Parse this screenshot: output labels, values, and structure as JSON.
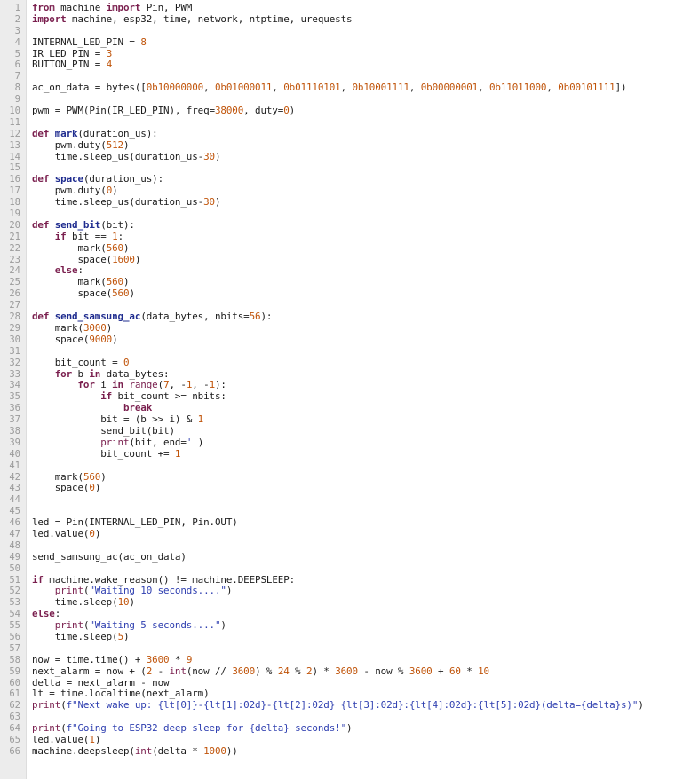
{
  "editor": {
    "theme": {
      "keyword": "#7a1f4e",
      "function": "#1f2c8f",
      "number": "#c0540a",
      "string": "#2f3fb0",
      "text": "#1b1b1b",
      "gutter_bg": "#ececec"
    },
    "lines": [
      [
        [
          "kw",
          "from"
        ],
        [
          "t",
          " machine "
        ],
        [
          "kw",
          "import"
        ],
        [
          "t",
          " Pin, PWM"
        ]
      ],
      [
        [
          "kw",
          "import"
        ],
        [
          "t",
          " machine, esp32, time, network, ntptime, urequests"
        ]
      ],
      [],
      [
        [
          "t",
          "INTERNAL_LED_PIN = "
        ],
        [
          "num",
          "8"
        ]
      ],
      [
        [
          "t",
          "IR_LED_PIN = "
        ],
        [
          "num",
          "3"
        ]
      ],
      [
        [
          "t",
          "BUTTON_PIN = "
        ],
        [
          "num",
          "4"
        ]
      ],
      [],
      [
        [
          "t",
          "ac_on_data = bytes(["
        ],
        [
          "num",
          "0b10000000"
        ],
        [
          "t",
          ", "
        ],
        [
          "num",
          "0b01000011"
        ],
        [
          "t",
          ", "
        ],
        [
          "num",
          "0b01110101"
        ],
        [
          "t",
          ", "
        ],
        [
          "num",
          "0b10001111"
        ],
        [
          "t",
          ", "
        ],
        [
          "num",
          "0b00000001"
        ],
        [
          "t",
          ", "
        ],
        [
          "num",
          "0b11011000"
        ],
        [
          "t",
          ", "
        ],
        [
          "num",
          "0b00101111"
        ],
        [
          "t",
          "])"
        ]
      ],
      [],
      [
        [
          "t",
          "pwm = PWM(Pin(IR_LED_PIN), freq="
        ],
        [
          "num",
          "38000"
        ],
        [
          "t",
          ", duty="
        ],
        [
          "num",
          "0"
        ],
        [
          "t",
          ")"
        ]
      ],
      [],
      [
        [
          "kw",
          "def"
        ],
        [
          "t",
          " "
        ],
        [
          "fn",
          "mark"
        ],
        [
          "t",
          "(duration_us):"
        ]
      ],
      [
        [
          "t",
          "    pwm.duty("
        ],
        [
          "num",
          "512"
        ],
        [
          "t",
          ")"
        ]
      ],
      [
        [
          "t",
          "    time.sleep_us(duration_us-"
        ],
        [
          "num",
          "30"
        ],
        [
          "t",
          ")"
        ]
      ],
      [],
      [
        [
          "kw",
          "def"
        ],
        [
          "t",
          " "
        ],
        [
          "fn",
          "space"
        ],
        [
          "t",
          "(duration_us):"
        ]
      ],
      [
        [
          "t",
          "    pwm.duty("
        ],
        [
          "num",
          "0"
        ],
        [
          "t",
          ")"
        ]
      ],
      [
        [
          "t",
          "    time.sleep_us(duration_us-"
        ],
        [
          "num",
          "30"
        ],
        [
          "t",
          ")"
        ]
      ],
      [],
      [
        [
          "kw",
          "def"
        ],
        [
          "t",
          " "
        ],
        [
          "fn",
          "send_bit"
        ],
        [
          "t",
          "(bit):"
        ]
      ],
      [
        [
          "t",
          "    "
        ],
        [
          "kw",
          "if"
        ],
        [
          "t",
          " bit == "
        ],
        [
          "num",
          "1"
        ],
        [
          "t",
          ":"
        ]
      ],
      [
        [
          "t",
          "        mark("
        ],
        [
          "num",
          "560"
        ],
        [
          "t",
          ")"
        ]
      ],
      [
        [
          "t",
          "        space("
        ],
        [
          "num",
          "1600"
        ],
        [
          "t",
          ")"
        ]
      ],
      [
        [
          "t",
          "    "
        ],
        [
          "kw",
          "else"
        ],
        [
          "t",
          ":"
        ]
      ],
      [
        [
          "t",
          "        mark("
        ],
        [
          "num",
          "560"
        ],
        [
          "t",
          ")"
        ]
      ],
      [
        [
          "t",
          "        space("
        ],
        [
          "num",
          "560"
        ],
        [
          "t",
          ")"
        ]
      ],
      [],
      [
        [
          "kw",
          "def"
        ],
        [
          "t",
          " "
        ],
        [
          "fn",
          "send_samsung_ac"
        ],
        [
          "t",
          "(data_bytes, nbits="
        ],
        [
          "num",
          "56"
        ],
        [
          "t",
          "):"
        ]
      ],
      [
        [
          "t",
          "    mark("
        ],
        [
          "num",
          "3000"
        ],
        [
          "t",
          ")"
        ]
      ],
      [
        [
          "t",
          "    space("
        ],
        [
          "num",
          "9000"
        ],
        [
          "t",
          ")"
        ]
      ],
      [],
      [
        [
          "t",
          "    bit_count = "
        ],
        [
          "num",
          "0"
        ]
      ],
      [
        [
          "t",
          "    "
        ],
        [
          "kw",
          "for"
        ],
        [
          "t",
          " b "
        ],
        [
          "kw",
          "in"
        ],
        [
          "t",
          " data_bytes:"
        ]
      ],
      [
        [
          "t",
          "        "
        ],
        [
          "kw",
          "for"
        ],
        [
          "t",
          " i "
        ],
        [
          "kw",
          "in"
        ],
        [
          "t",
          " "
        ],
        [
          "bi",
          "range"
        ],
        [
          "t",
          "("
        ],
        [
          "num",
          "7"
        ],
        [
          "t",
          ", -"
        ],
        [
          "num",
          "1"
        ],
        [
          "t",
          ", -"
        ],
        [
          "num",
          "1"
        ],
        [
          "t",
          "):"
        ]
      ],
      [
        [
          "t",
          "            "
        ],
        [
          "kw",
          "if"
        ],
        [
          "t",
          " bit_count >= nbits:"
        ]
      ],
      [
        [
          "t",
          "                "
        ],
        [
          "kw",
          "break"
        ]
      ],
      [
        [
          "t",
          "            bit = (b >> i) & "
        ],
        [
          "num",
          "1"
        ]
      ],
      [
        [
          "t",
          "            send_bit(bit)"
        ]
      ],
      [
        [
          "t",
          "            "
        ],
        [
          "bi",
          "print"
        ],
        [
          "t",
          "(bit, end="
        ],
        [
          "str",
          "''"
        ],
        [
          "t",
          ")"
        ]
      ],
      [
        [
          "t",
          "            bit_count += "
        ],
        [
          "num",
          "1"
        ]
      ],
      [],
      [
        [
          "t",
          "    mark("
        ],
        [
          "num",
          "560"
        ],
        [
          "t",
          ")"
        ]
      ],
      [
        [
          "t",
          "    space("
        ],
        [
          "num",
          "0"
        ],
        [
          "t",
          ")"
        ]
      ],
      [],
      [],
      [
        [
          "t",
          "led = Pin(INTERNAL_LED_PIN, Pin.OUT)"
        ]
      ],
      [
        [
          "t",
          "led.value("
        ],
        [
          "num",
          "0"
        ],
        [
          "t",
          ")"
        ]
      ],
      [],
      [
        [
          "t",
          "send_samsung_ac(ac_on_data)"
        ]
      ],
      [],
      [
        [
          "kw",
          "if"
        ],
        [
          "t",
          " machine.wake_reason() != machine.DEEPSLEEP:"
        ]
      ],
      [
        [
          "t",
          "    "
        ],
        [
          "bi",
          "print"
        ],
        [
          "t",
          "("
        ],
        [
          "str",
          "\"Waiting 10 seconds....\""
        ],
        [
          "t",
          ")"
        ]
      ],
      [
        [
          "t",
          "    time.sleep("
        ],
        [
          "num",
          "10"
        ],
        [
          "t",
          ")"
        ]
      ],
      [
        [
          "kw",
          "else"
        ],
        [
          "t",
          ":"
        ]
      ],
      [
        [
          "t",
          "    "
        ],
        [
          "bi",
          "print"
        ],
        [
          "t",
          "("
        ],
        [
          "str",
          "\"Waiting 5 seconds....\""
        ],
        [
          "t",
          ")"
        ]
      ],
      [
        [
          "t",
          "    time.sleep("
        ],
        [
          "num",
          "5"
        ],
        [
          "t",
          ")"
        ]
      ],
      [],
      [
        [
          "t",
          "now = time.time() + "
        ],
        [
          "num",
          "3600"
        ],
        [
          "t",
          " * "
        ],
        [
          "num",
          "9"
        ]
      ],
      [
        [
          "t",
          "next_alarm = now + ("
        ],
        [
          "num",
          "2"
        ],
        [
          "t",
          " - "
        ],
        [
          "bi",
          "int"
        ],
        [
          "t",
          "(now // "
        ],
        [
          "num",
          "3600"
        ],
        [
          "t",
          ") % "
        ],
        [
          "num",
          "24"
        ],
        [
          "t",
          " % "
        ],
        [
          "num",
          "2"
        ],
        [
          "t",
          ") * "
        ],
        [
          "num",
          "3600"
        ],
        [
          "t",
          " - now % "
        ],
        [
          "num",
          "3600"
        ],
        [
          "t",
          " + "
        ],
        [
          "num",
          "60"
        ],
        [
          "t",
          " * "
        ],
        [
          "num",
          "10"
        ]
      ],
      [
        [
          "t",
          "delta = next_alarm - now"
        ]
      ],
      [
        [
          "t",
          "lt = time.localtime(next_alarm)"
        ]
      ],
      [
        [
          "bi",
          "print"
        ],
        [
          "t",
          "("
        ],
        [
          "str",
          "f\"Next wake up: {lt[0]}-{lt[1]:02d}-{lt[2]:02d} {lt[3]:02d}:{lt[4]:02d}:{lt[5]:02d}(delta={delta}s)\""
        ],
        [
          "t",
          ")"
        ]
      ],
      [],
      [
        [
          "bi",
          "print"
        ],
        [
          "t",
          "("
        ],
        [
          "str",
          "f\"Going to ESP32 deep sleep for {delta} seconds!\""
        ],
        [
          "t",
          ")"
        ]
      ],
      [
        [
          "t",
          "led.value("
        ],
        [
          "num",
          "1"
        ],
        [
          "t",
          ")"
        ]
      ],
      [
        [
          "t",
          "machine.deepsleep("
        ],
        [
          "bi",
          "int"
        ],
        [
          "t",
          "(delta * "
        ],
        [
          "num",
          "1000"
        ],
        [
          "t",
          "))"
        ]
      ]
    ]
  }
}
